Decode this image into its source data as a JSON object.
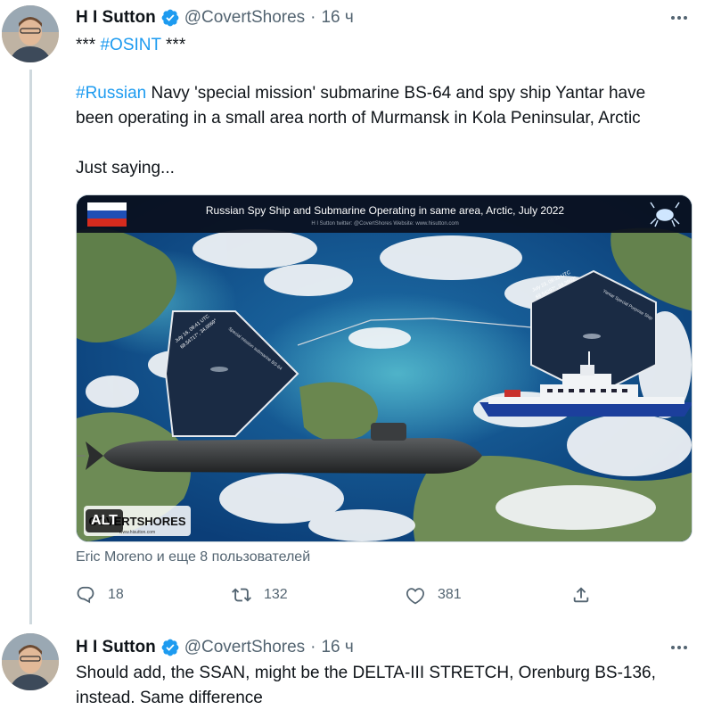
{
  "tweets": [
    {
      "author": "H I Sutton",
      "handle": "@CovertShores",
      "separator": "·",
      "time": "16 ч",
      "line1_prefix": "*** ",
      "line1_hashtag": "#OSINT",
      "line1_suffix": " ***",
      "para_hashtag": "#Russian",
      "para_line1": " Navy 'special mission' submarine BS-64 and spy ship Yantar have",
      "para_line2": "been operating in a small area north of Murmansk in Kola Peninsular, Arctic",
      "closing": "Just saying...",
      "media": {
        "title": "Russian Spy Ship and Submarine Operating in same area, Arctic, July 2022",
        "credit": "H I Sutton  twitter: @CovertShores  Website: www.hisutton.com",
        "left_inset_date": "July 16, 09:41 UTC",
        "left_inset_coords": "69.54717°, 34.0069°",
        "left_inset_label": "Special mission submarine BS-64",
        "right_inset_date": "July 23, 09:33 UTC",
        "right_inset_coords": "69.54297°, 34.3902°",
        "right_inset_label": "Yantar Special Purpose Ship",
        "watermark": "COVERTSHORES",
        "watermark_url": "www.hisutton.com",
        "alt_label": "ALT",
        "flag_colors": [
          "#ffffff",
          "#1f4fb5",
          "#d52b1e"
        ]
      },
      "liked_by": "Eric Moreno и еще 8 пользователей",
      "stats": {
        "replies": "18",
        "retweets": "132",
        "likes": "381"
      }
    },
    {
      "author": "H I Sutton",
      "handle": "@CovertShores",
      "separator": "·",
      "time": "16 ч",
      "line1": "Should add, the SSAN, might be the DELTA-III STRETCH, Orenburg BS-136,",
      "line2": "instead. Same difference"
    }
  ],
  "icons": {
    "verified": "verified-badge-icon",
    "more": "more-icon",
    "reply": "reply-icon",
    "retweet": "retweet-icon",
    "like": "like-icon",
    "share": "share-icon"
  },
  "colors": {
    "accent": "#1d9bf0",
    "text": "#0f1419",
    "secondary": "#536471",
    "border": "#cfd9de"
  }
}
